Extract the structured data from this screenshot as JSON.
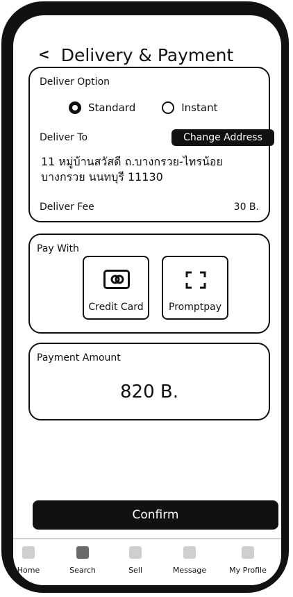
{
  "header": {
    "back_glyph": "<",
    "title": "Delivery & Payment"
  },
  "delivery": {
    "section_label": "Deliver Option",
    "options": [
      {
        "label": "Standard",
        "selected": true
      },
      {
        "label": "Instant",
        "selected": false
      }
    ],
    "deliver_to_label": "Deliver To",
    "change_address_label": "Change Address",
    "address_line1": "11 หมู่บ้านสวัสดี ถ.บางกรวย-ไทรน้อย",
    "address_line2": "บางกรวย นนทบุรี 11130",
    "fee_label": "Deliver Fee",
    "fee_value": "30 B."
  },
  "payment": {
    "section_label": "Pay With",
    "methods": [
      {
        "label": "Credit Card",
        "icon": "credit-card-icon"
      },
      {
        "label": "Promptpay",
        "icon": "qr-scan-icon"
      }
    ]
  },
  "amount": {
    "label": "Payment Amount",
    "value": "820 B."
  },
  "confirm_label": "Confirm",
  "nav": {
    "items": [
      {
        "label": "Home",
        "active": false
      },
      {
        "label": "Search",
        "active": true
      },
      {
        "label": "Sell",
        "active": false
      },
      {
        "label": "Message",
        "active": false
      },
      {
        "label": "My Profile",
        "active": false
      }
    ]
  },
  "colors": {
    "primary": "#111111",
    "inactive_icon": "#cfcfcf",
    "active_icon": "#6a6a6a"
  }
}
